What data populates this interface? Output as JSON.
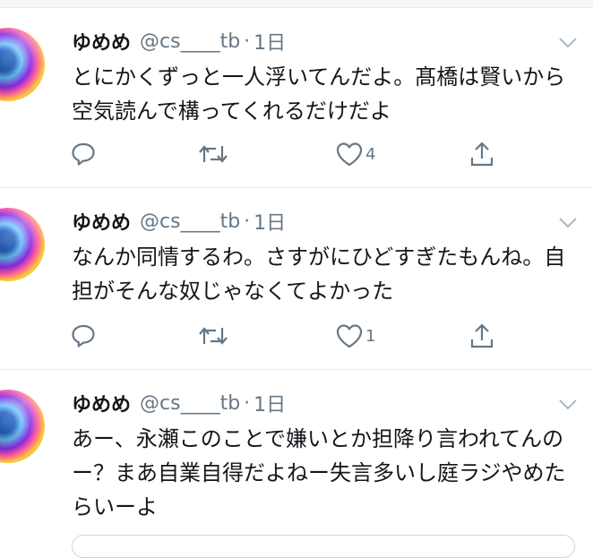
{
  "colors": {
    "icon": "#657786",
    "text": "#14171a",
    "border": "#e6ecf0"
  },
  "tweets": [
    {
      "name": "ゆめめ",
      "handle": "@cs____tb",
      "separator": "·",
      "time": "1日",
      "text": "とにかくずっと一人浮いてんだよ。髙橋は賢いから空気読んで構ってくれるだけだよ",
      "reply_icon": "reply-icon",
      "retweet_icon": "retweet-icon",
      "like_icon": "heart-icon",
      "like_count": "4",
      "share_icon": "share-icon",
      "menu_icon": "chevron-down-icon"
    },
    {
      "name": "ゆめめ",
      "handle": "@cs____tb",
      "separator": "·",
      "time": "1日",
      "text": "なんか同情するわ。さすがにひどすぎたもんね。自担がそんな奴じゃなくてよかった",
      "reply_icon": "reply-icon",
      "retweet_icon": "retweet-icon",
      "like_icon": "heart-icon",
      "like_count": "1",
      "share_icon": "share-icon",
      "menu_icon": "chevron-down-icon"
    },
    {
      "name": "ゆめめ",
      "handle": "@cs____tb",
      "separator": "·",
      "time": "1日",
      "text": "あー、永瀬このことで嫌いとか担降り言われてんのー？まあ自業自得だよねー失言多いし庭ラジやめたらいーよ",
      "menu_icon": "chevron-down-icon"
    }
  ]
}
